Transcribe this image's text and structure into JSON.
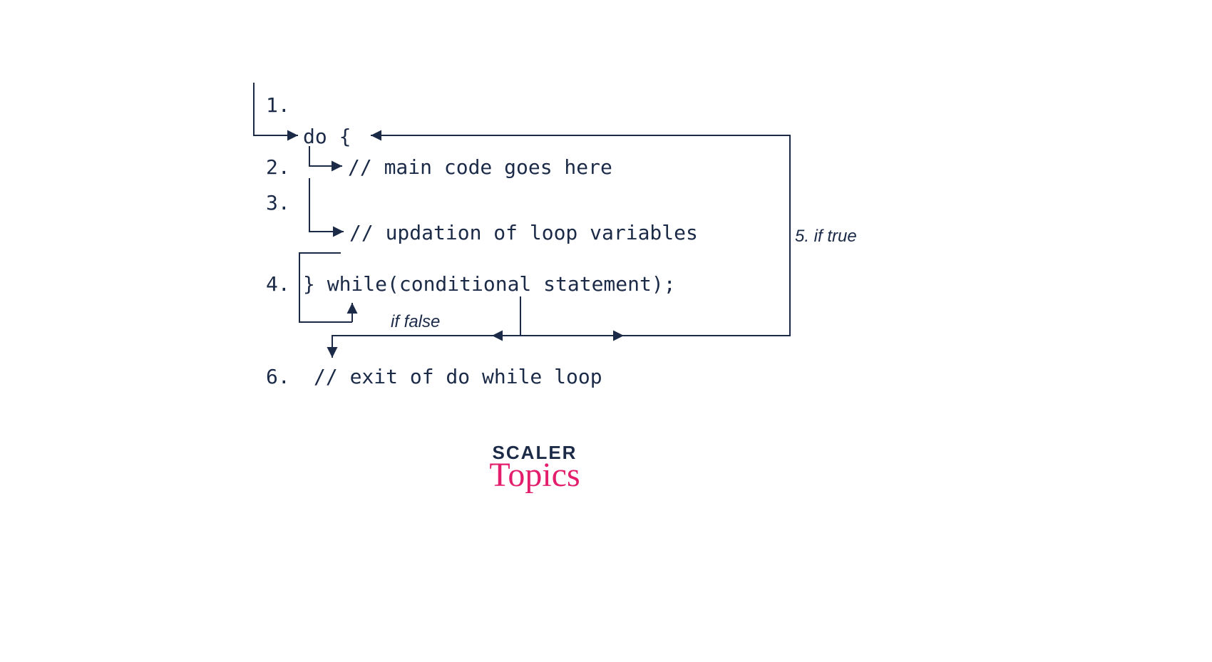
{
  "lines": {
    "n1": "1.",
    "n2": "2.",
    "n3": "3.",
    "n4": "4.",
    "n6": "6.",
    "do": "do {",
    "main": "// main code goes here",
    "upd": "// updation of loop variables",
    "while": "} while(conditional statement);",
    "exit": "// exit of do while loop"
  },
  "annot": {
    "ifTrue": "5. if true",
    "ifFalse": "if false"
  },
  "brand": {
    "scaler": "SCALER",
    "topics": "Topics"
  },
  "color": {
    "ink": "#1b2a47",
    "pink": "#e21e6d"
  }
}
